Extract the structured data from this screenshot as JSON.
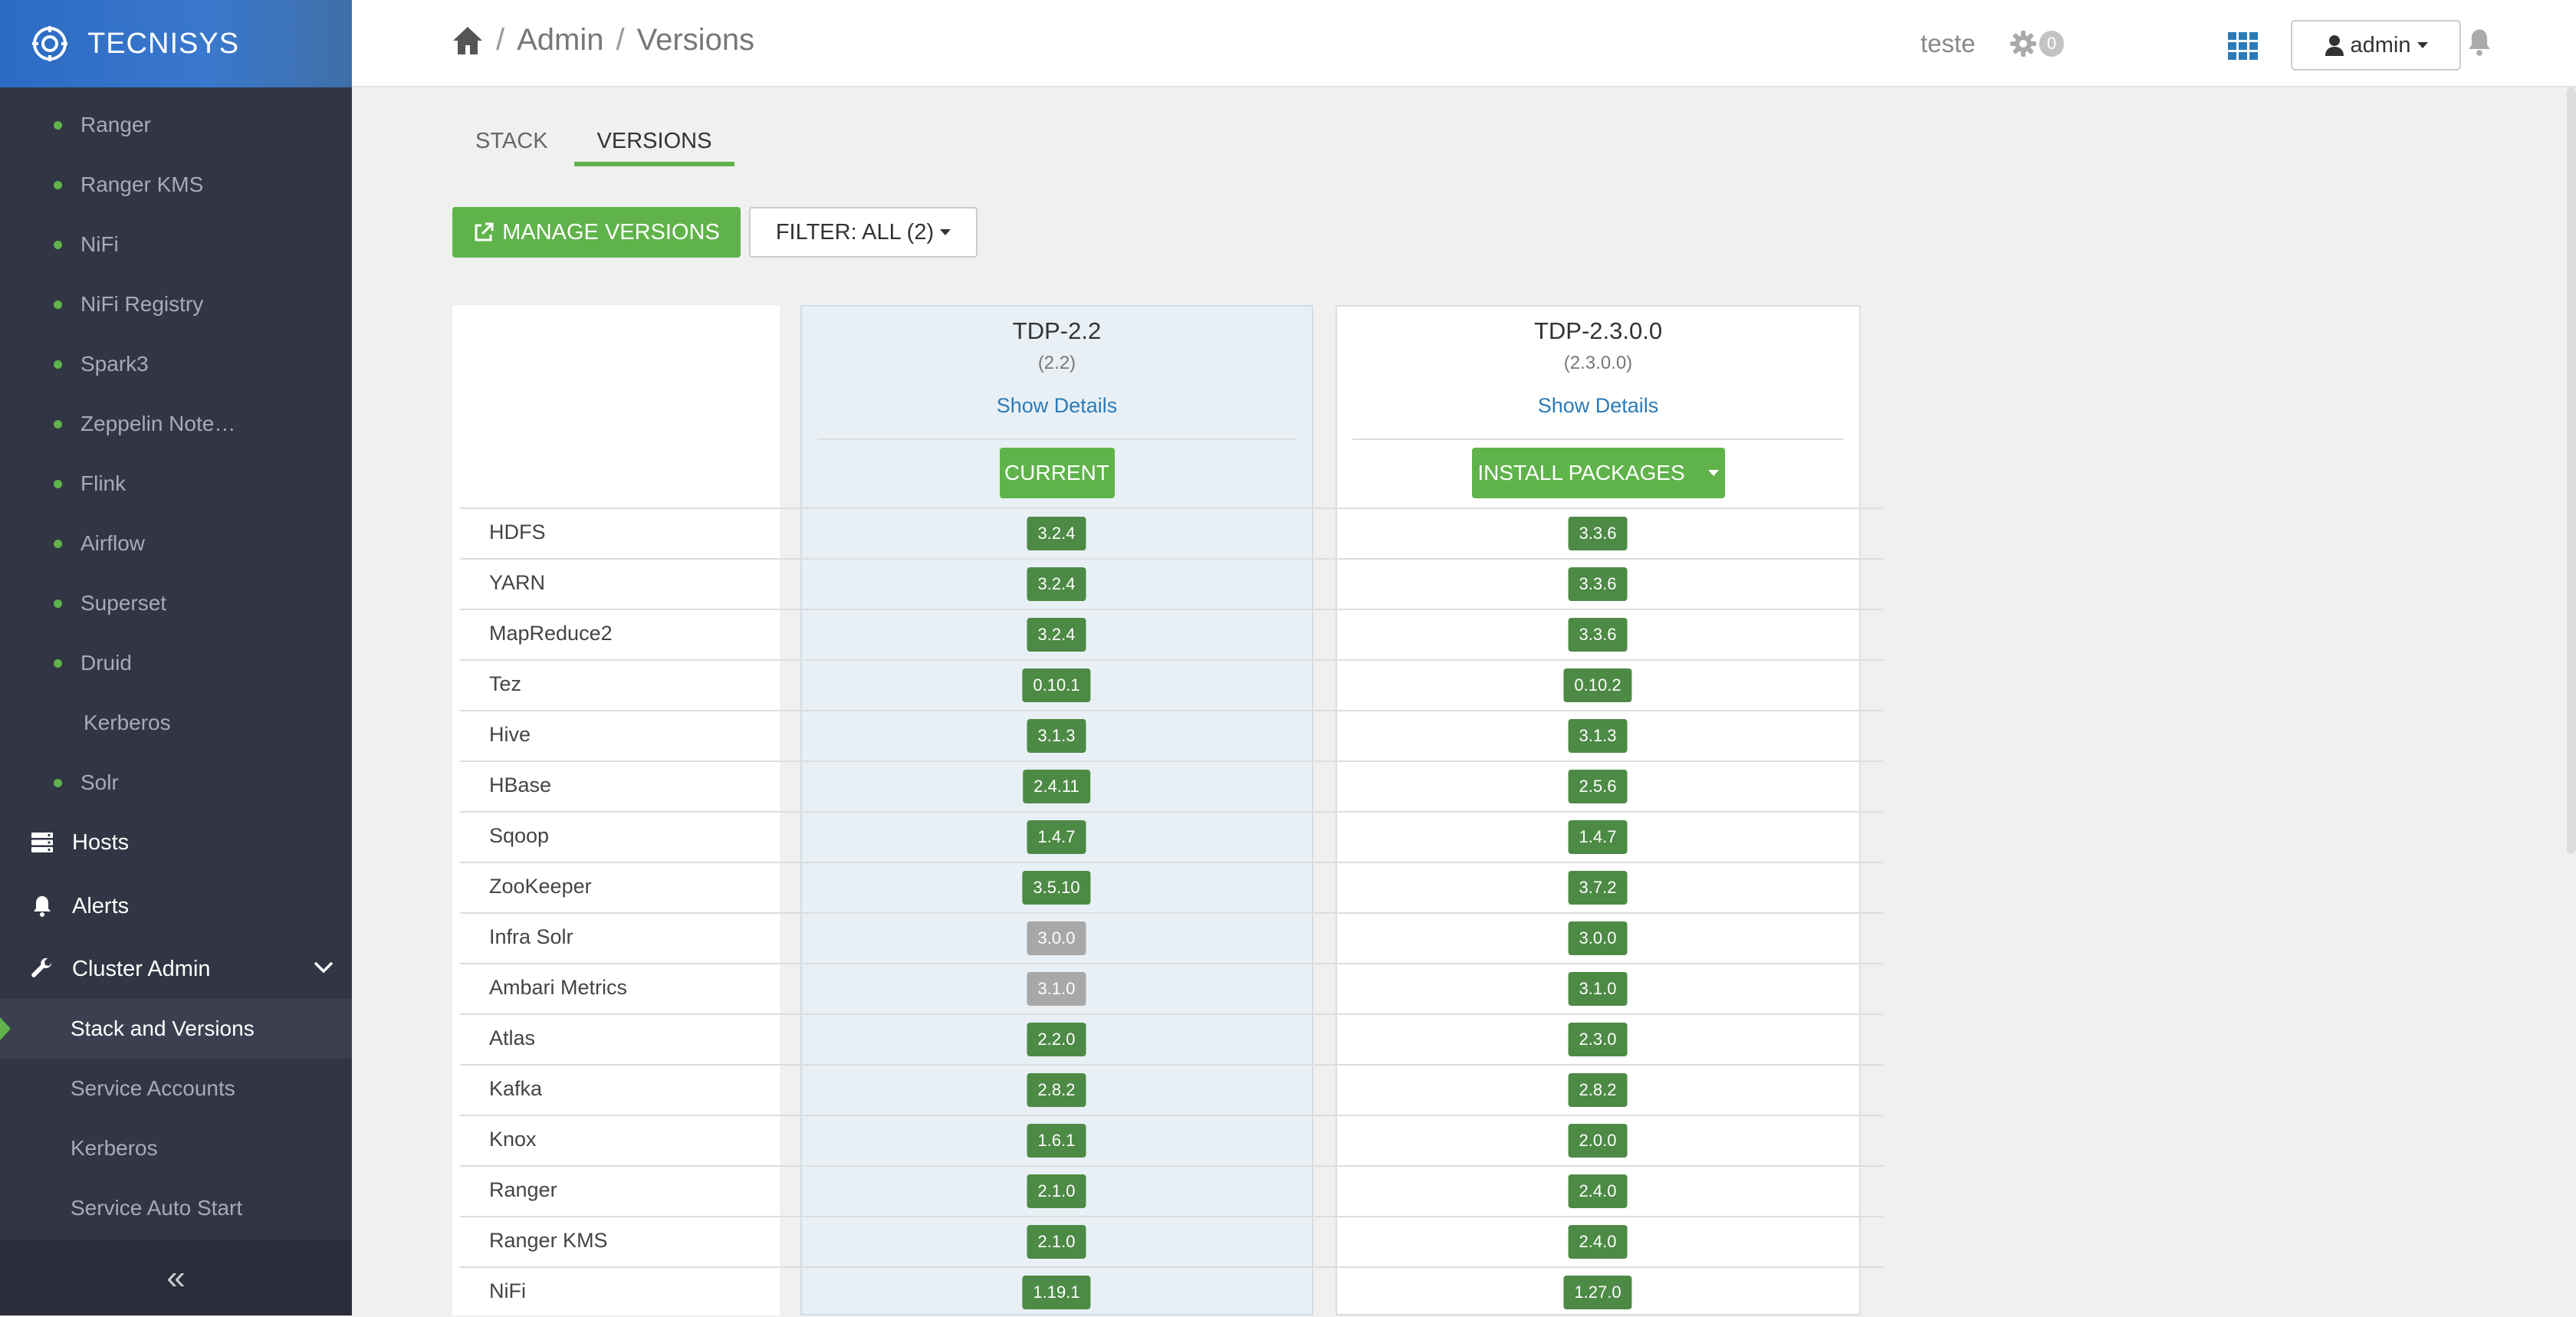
{
  "brand": {
    "name": "TECNISYS"
  },
  "sidebar": {
    "services": [
      {
        "label": "Ranger",
        "status": "green"
      },
      {
        "label": "Ranger KMS",
        "status": "green"
      },
      {
        "label": "NiFi",
        "status": "green"
      },
      {
        "label": "NiFi Registry",
        "status": "green"
      },
      {
        "label": "Spark3",
        "status": "green"
      },
      {
        "label": "Zeppelin Note…",
        "status": "green"
      },
      {
        "label": "Flink",
        "status": "green"
      },
      {
        "label": "Airflow",
        "status": "green"
      },
      {
        "label": "Superset",
        "status": "green"
      },
      {
        "label": "Druid",
        "status": "green"
      },
      {
        "label": "Kerberos",
        "status": "none"
      },
      {
        "label": "Solr",
        "status": "green"
      }
    ],
    "hosts": "Hosts",
    "alerts": "Alerts",
    "cluster_admin": "Cluster Admin",
    "sub_items": [
      "Stack and Versions",
      "Service Accounts",
      "Kerberos",
      "Service Auto Start"
    ],
    "collapse": "«"
  },
  "breadcrumb": {
    "admin": "Admin",
    "page": "Versions",
    "sep": "/"
  },
  "topbar": {
    "cluster": "teste",
    "ops_count": "0",
    "user": "admin"
  },
  "tabs": [
    "STACK",
    "VERSIONS"
  ],
  "actions": {
    "manage": "MANAGE VERSIONS",
    "filter": "FILTER: ALL (2)"
  },
  "versions": [
    {
      "name": "TDP-2.2",
      "sub": "(2.2)",
      "details": "Show Details",
      "action": "CURRENT"
    },
    {
      "name": "TDP-2.3.0.0",
      "sub": "(2.3.0.0)",
      "details": "Show Details",
      "action": "INSTALL PACKAGES"
    }
  ],
  "components": [
    {
      "name": "HDFS",
      "v1": "3.2.4",
      "v2": "3.3.6",
      "v1_installed": true
    },
    {
      "name": "YARN",
      "v1": "3.2.4",
      "v2": "3.3.6",
      "v1_installed": true
    },
    {
      "name": "MapReduce2",
      "v1": "3.2.4",
      "v2": "3.3.6",
      "v1_installed": true
    },
    {
      "name": "Tez",
      "v1": "0.10.1",
      "v2": "0.10.2",
      "v1_installed": true
    },
    {
      "name": "Hive",
      "v1": "3.1.3",
      "v2": "3.1.3",
      "v1_installed": true
    },
    {
      "name": "HBase",
      "v1": "2.4.11",
      "v2": "2.5.6",
      "v1_installed": true
    },
    {
      "name": "Sqoop",
      "v1": "1.4.7",
      "v2": "1.4.7",
      "v1_installed": true
    },
    {
      "name": "ZooKeeper",
      "v1": "3.5.10",
      "v2": "3.7.2",
      "v1_installed": true
    },
    {
      "name": "Infra Solr",
      "v1": "3.0.0",
      "v2": "3.0.0",
      "v1_installed": false
    },
    {
      "name": "Ambari Metrics",
      "v1": "3.1.0",
      "v2": "3.1.0",
      "v1_installed": false
    },
    {
      "name": "Atlas",
      "v1": "2.2.0",
      "v2": "2.3.0",
      "v1_installed": true
    },
    {
      "name": "Kafka",
      "v1": "2.8.2",
      "v2": "2.8.2",
      "v1_installed": true
    },
    {
      "name": "Knox",
      "v1": "1.6.1",
      "v2": "2.0.0",
      "v1_installed": true
    },
    {
      "name": "Ranger",
      "v1": "2.1.0",
      "v2": "2.4.0",
      "v1_installed": true
    },
    {
      "name": "Ranger KMS",
      "v1": "2.1.0",
      "v2": "2.4.0",
      "v1_installed": true
    },
    {
      "name": "NiFi",
      "v1": "1.19.1",
      "v2": "1.27.0",
      "v1_installed": true
    }
  ],
  "colors": {
    "accent": "#5fb34a",
    "pill": "#4d8a45",
    "pill_grey": "#a8a8a8",
    "sidebar": "#323544"
  }
}
